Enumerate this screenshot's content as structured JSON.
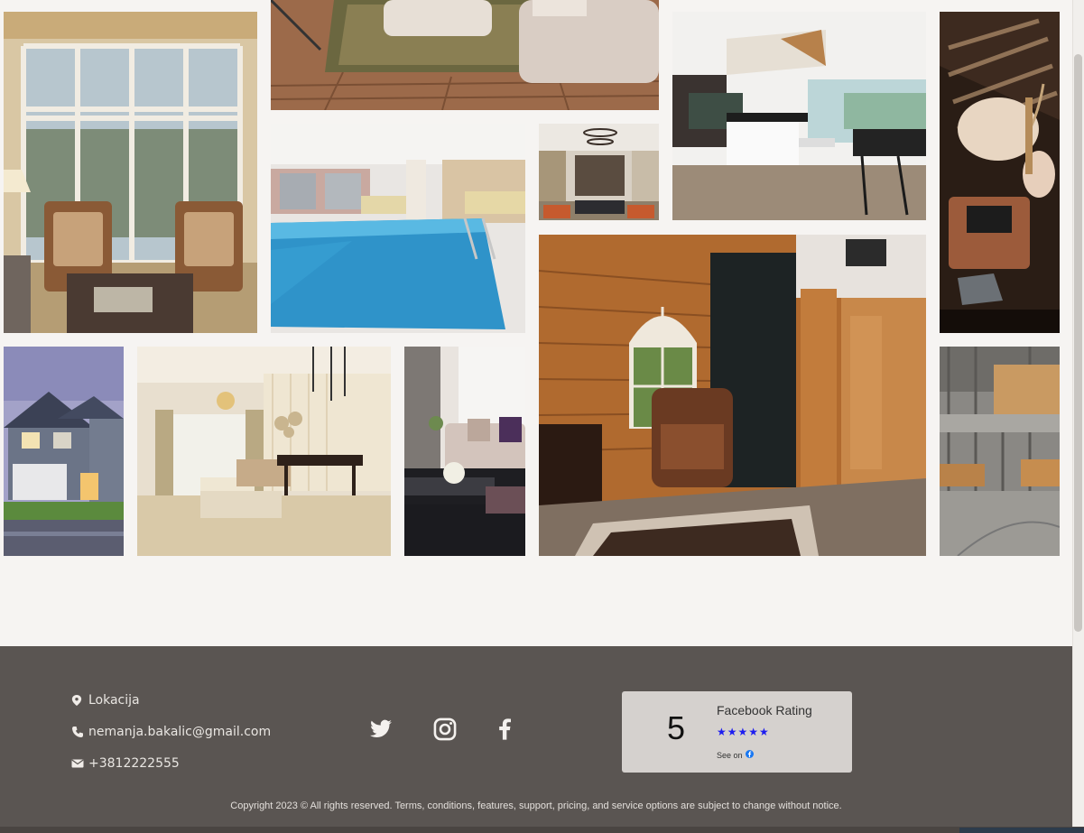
{
  "gallery": {
    "images": [
      {
        "name": "living-room-windows"
      },
      {
        "name": "rug-sofa-floor"
      },
      {
        "name": "indoor-pool"
      },
      {
        "name": "open-living-kitchen"
      },
      {
        "name": "modern-kitchen"
      },
      {
        "name": "dark-still-life"
      },
      {
        "name": "house-exterior"
      },
      {
        "name": "dining-living-room"
      },
      {
        "name": "sofa-living-room"
      },
      {
        "name": "wood-room-armchair"
      },
      {
        "name": "concrete-interior"
      }
    ]
  },
  "footer": {
    "location": "Lokacija",
    "email": "nemanja.bakalic@gmail.com",
    "phone": "+3812222555",
    "social": [
      "twitter-icon",
      "instagram-icon",
      "facebook-icon"
    ],
    "rating": {
      "score": "5",
      "title": "Facebook Rating",
      "stars": "★★★★★",
      "see_on": "See on"
    },
    "copyright": "Copyright 2023 © All rights reserved. Terms, conditions, features, support, pricing, and service options are subject to change without notice."
  },
  "colors": {
    "page_bg": "#f6f4f2",
    "footer_bg": "#5a5552",
    "rating_box": "#d5d1ce",
    "stars": "#1d1df0"
  }
}
